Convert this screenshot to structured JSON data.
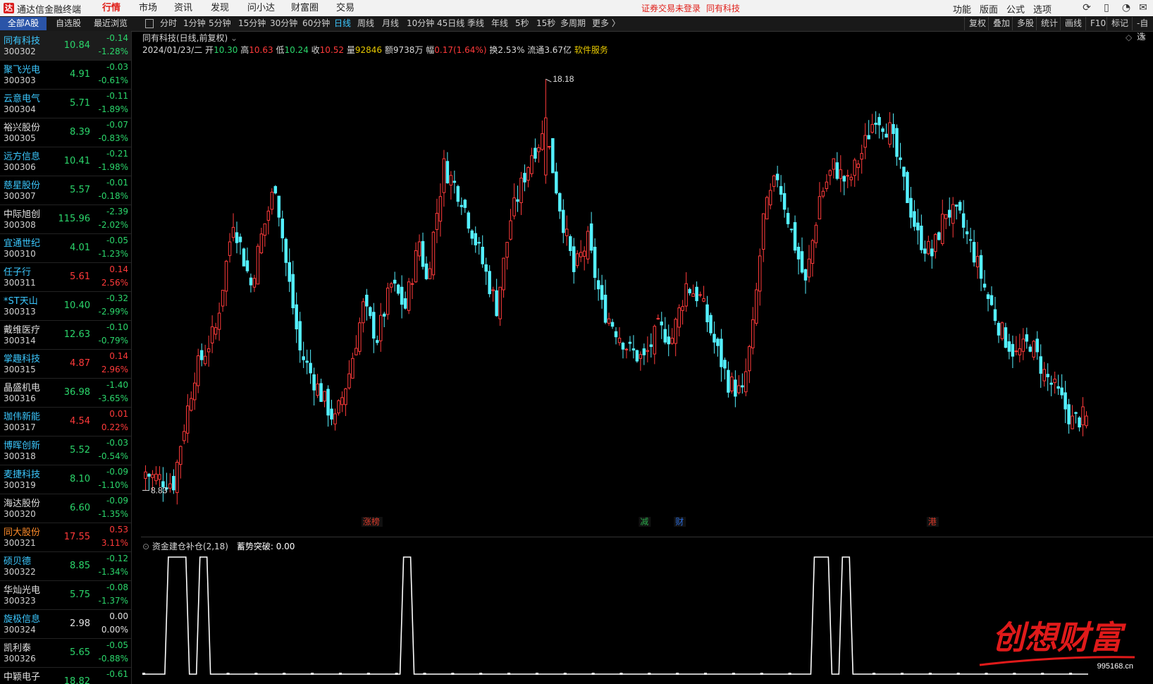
{
  "titlebar": {
    "logo": "达",
    "app_title": "通达信金融终端",
    "menus": [
      "行情",
      "市场",
      "资讯",
      "发现",
      "问小达",
      "财富圈",
      "交易"
    ],
    "active_menu": "行情",
    "login_status": "证券交易未登录",
    "current_stock": "同有科技",
    "right_menus": [
      "功能",
      "版面",
      "公式",
      "选项"
    ]
  },
  "tabs": {
    "list_tabs": [
      "全部A股",
      "自选股",
      "最近浏览"
    ],
    "periods": [
      "分时",
      "1分钟",
      "5分钟",
      "15分钟",
      "30分钟",
      "60分钟",
      "日线",
      "周线",
      "月线",
      "10分钟",
      "45日线",
      "季线",
      "年线",
      "5秒",
      "15秒",
      "多周期",
      "更多 〉"
    ],
    "active_period": "日线",
    "right_tools": [
      "复权",
      "叠加",
      "多股",
      "统计",
      "画线",
      "F10",
      "标记",
      "-自选"
    ]
  },
  "stocks": [
    {
      "name": "同有科技",
      "code": "300302",
      "price": "10.84",
      "chg": "-0.14",
      "pct": "-1.28%",
      "dir": "down",
      "name_color": "#3cc8ff",
      "selected": true
    },
    {
      "name": "聚飞光电",
      "code": "300303",
      "price": "4.91",
      "chg": "-0.03",
      "pct": "-0.61%",
      "dir": "down",
      "name_color": "#3cc8ff"
    },
    {
      "name": "云意电气",
      "code": "300304",
      "price": "5.71",
      "chg": "-0.11",
      "pct": "-1.89%",
      "dir": "down",
      "name_color": "#3cc8ff"
    },
    {
      "name": "裕兴股份",
      "code": "300305",
      "price": "8.39",
      "chg": "-0.07",
      "pct": "-0.83%",
      "dir": "down",
      "name_color": "#e0e0e0"
    },
    {
      "name": "远方信息",
      "code": "300306",
      "price": "10.41",
      "chg": "-0.21",
      "pct": "-1.98%",
      "dir": "down",
      "name_color": "#3cc8ff"
    },
    {
      "name": "慈星股份",
      "code": "300307",
      "price": "5.57",
      "chg": "-0.01",
      "pct": "-0.18%",
      "dir": "down",
      "name_color": "#3cc8ff"
    },
    {
      "name": "中际旭创",
      "code": "300308",
      "price": "115.96",
      "chg": "-2.39",
      "pct": "-2.02%",
      "dir": "down",
      "name_color": "#e0e0e0"
    },
    {
      "name": "宜通世纪",
      "code": "300310",
      "price": "4.01",
      "chg": "-0.05",
      "pct": "-1.23%",
      "dir": "down",
      "name_color": "#3cc8ff"
    },
    {
      "name": "任子行",
      "code": "300311",
      "price": "5.61",
      "chg": "0.14",
      "pct": "2.56%",
      "dir": "up",
      "name_color": "#3cc8ff"
    },
    {
      "name": "*ST天山",
      "code": "300313",
      "price": "10.40",
      "chg": "-0.32",
      "pct": "-2.99%",
      "dir": "down",
      "name_color": "#3cc8ff"
    },
    {
      "name": "戴维医疗",
      "code": "300314",
      "price": "12.63",
      "chg": "-0.10",
      "pct": "-0.79%",
      "dir": "down",
      "name_color": "#e0e0e0"
    },
    {
      "name": "掌趣科技",
      "code": "300315",
      "price": "4.87",
      "chg": "0.14",
      "pct": "2.96%",
      "dir": "up",
      "name_color": "#3cc8ff"
    },
    {
      "name": "晶盛机电",
      "code": "300316",
      "price": "36.98",
      "chg": "-1.40",
      "pct": "-3.65%",
      "dir": "down",
      "name_color": "#e0e0e0"
    },
    {
      "name": "珈伟新能",
      "code": "300317",
      "price": "4.54",
      "chg": "0.01",
      "pct": "0.22%",
      "dir": "up",
      "name_color": "#3cc8ff"
    },
    {
      "name": "博晖创新",
      "code": "300318",
      "price": "5.52",
      "chg": "-0.03",
      "pct": "-0.54%",
      "dir": "down",
      "name_color": "#3cc8ff"
    },
    {
      "name": "麦捷科技",
      "code": "300319",
      "price": "8.10",
      "chg": "-0.09",
      "pct": "-1.10%",
      "dir": "down",
      "name_color": "#3cc8ff"
    },
    {
      "name": "海达股份",
      "code": "300320",
      "price": "6.60",
      "chg": "-0.09",
      "pct": "-1.35%",
      "dir": "down",
      "name_color": "#e0e0e0"
    },
    {
      "name": "同大股份",
      "code": "300321",
      "price": "17.55",
      "chg": "0.53",
      "pct": "3.11%",
      "dir": "up",
      "name_color": "#ff8c2a"
    },
    {
      "name": "硕贝德",
      "code": "300322",
      "price": "8.85",
      "chg": "-0.12",
      "pct": "-1.34%",
      "dir": "down",
      "name_color": "#3cc8ff"
    },
    {
      "name": "华灿光电",
      "code": "300323",
      "price": "5.75",
      "chg": "-0.08",
      "pct": "-1.37%",
      "dir": "down",
      "name_color": "#e0e0e0"
    },
    {
      "name": "旋极信息",
      "code": "300324",
      "price": "2.98",
      "chg": "0.00",
      "pct": "0.00%",
      "dir": "flat",
      "name_color": "#3cc8ff"
    },
    {
      "name": "凯利泰",
      "code": "300326",
      "price": "5.65",
      "chg": "-0.05",
      "pct": "-0.88%",
      "dir": "down",
      "name_color": "#e0e0e0"
    },
    {
      "name": "中颖电子",
      "code": "",
      "price": "18.82",
      "chg": "-0.61",
      "pct": "",
      "dir": "down",
      "name_color": "#e0e0e0"
    }
  ],
  "chart": {
    "header": "同有科技(日线,前复权)",
    "date": "2024/01/23/二",
    "open_label": "开",
    "open": "10.30",
    "high_label": "高",
    "high": "10.63",
    "low_label": "低",
    "low": "10.24",
    "close_label": "收",
    "close": "10.52",
    "vol_label": "量",
    "vol": "92846",
    "amt_label": "额",
    "amt": "9738万",
    "amp_label": "幅",
    "amp": "0.17(1.64%)",
    "turn_label": "换",
    "turn": "2.53%",
    "float_label": "流通",
    "float": "3.67亿",
    "sector": "软件服务",
    "max_label": "18.18",
    "min_label": "8.83",
    "event_tags": [
      {
        "text": "涨榜",
        "color": "#d93a2a",
        "idx": 62
      },
      {
        "text": "减",
        "color": "#2aa84a",
        "idx": 141
      },
      {
        "text": "财",
        "color": "#2a6ad9",
        "idx": 151
      },
      {
        "text": "港",
        "color": "#d93a2a",
        "idx": 223
      }
    ],
    "colors": {
      "up": "#ff3b3b",
      "down": "#54f0ff",
      "bg": "#000000"
    }
  },
  "indicator": {
    "name": "资金建仓补仓(2,18)",
    "line_label": "蓄势突破:",
    "line_value": "0.00"
  },
  "watermark": {
    "text": "创想财富",
    "url": "995168.cn"
  },
  "chart_data": {
    "type": "candlestick",
    "ohlc_note": "daily OHLC, 前复权",
    "candles": []
  }
}
